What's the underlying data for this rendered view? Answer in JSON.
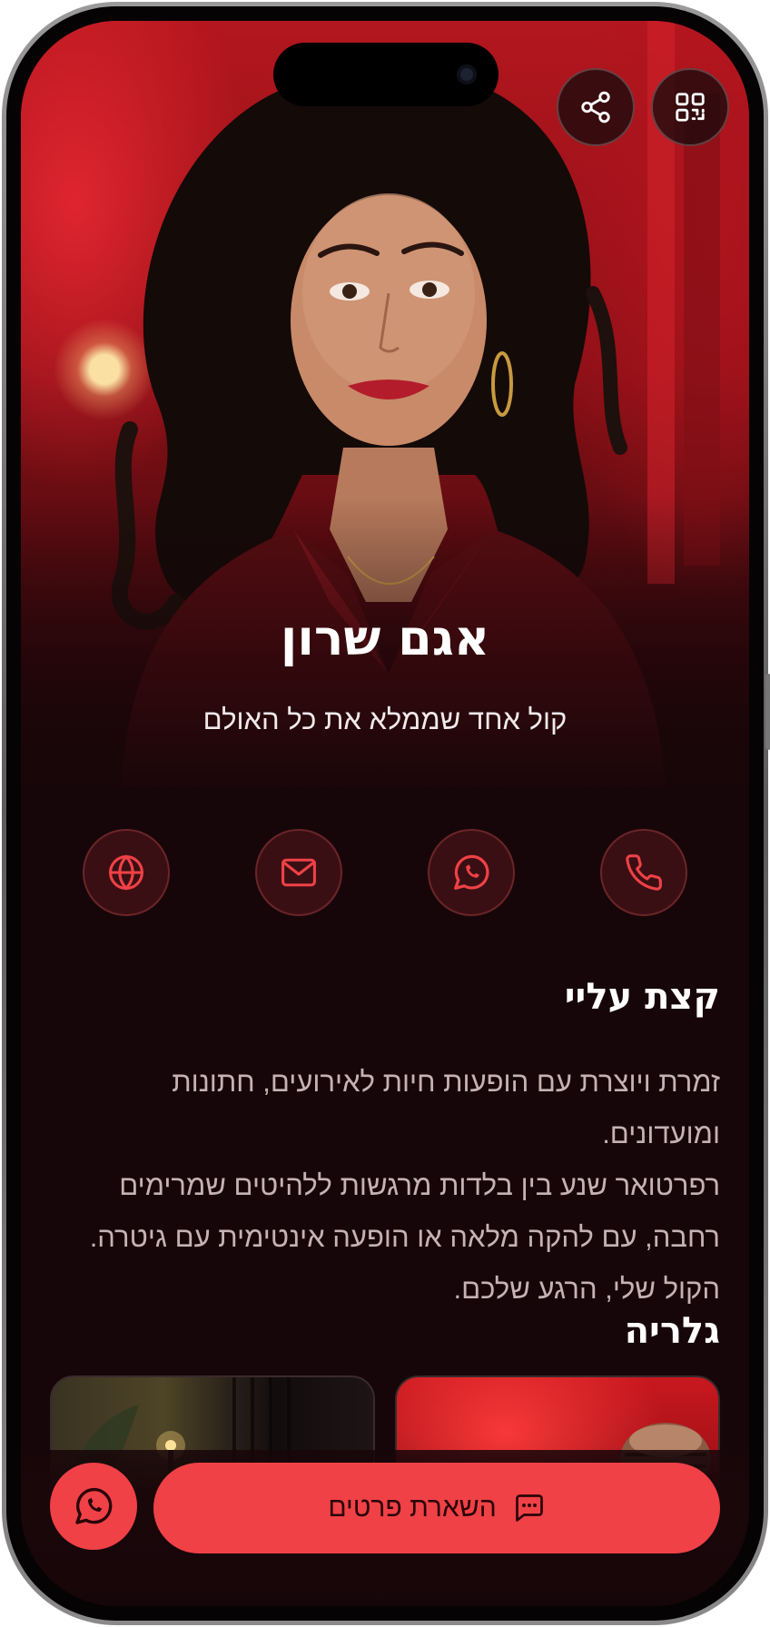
{
  "profile": {
    "name": "אגם שרון",
    "tagline": "קול אחד שממלא את כל האולם"
  },
  "top_actions": [
    {
      "icon": "qr-code-icon"
    },
    {
      "icon": "share-icon"
    }
  ],
  "contacts": [
    {
      "icon": "phone-icon"
    },
    {
      "icon": "whatsapp-icon"
    },
    {
      "icon": "mail-icon"
    },
    {
      "icon": "globe-icon"
    }
  ],
  "about": {
    "title": "קצת עליי",
    "lines": [
      "זמרת ויוצרת עם הופעות חיות לאירועים, חתונות ומועדונים.",
      "רפרטואר שנע בין בלדות מרגשות ללהיטים שמרימים",
      "רחבה, עם להקה מלאה או הופעה אינטימית עם גיטרה.",
      "הקול שלי, הרגע שלכם."
    ]
  },
  "gallery": {
    "title": "גלריה"
  },
  "bottom_bar": {
    "cta_label": "השארת פרטים",
    "cta_icon": "message-icon",
    "whatsapp_icon": "whatsapp-icon"
  },
  "colors": {
    "accent": "#ef4146",
    "background": "#170609",
    "contact_ring": "#6a2528",
    "text_muted": "#c5b2b4"
  }
}
